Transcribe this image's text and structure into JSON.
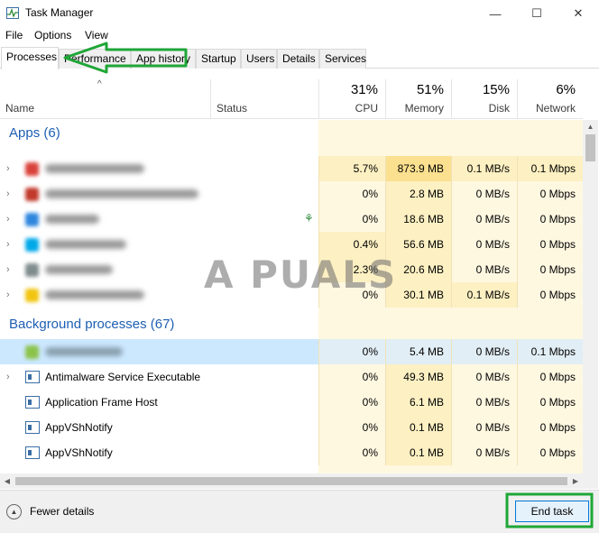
{
  "window": {
    "title": "Task Manager",
    "controls": {
      "minimize": "—",
      "maximize": "☐",
      "close": "✕"
    }
  },
  "menu": [
    "File",
    "Options",
    "View"
  ],
  "tabs": [
    "Processes",
    "Performance",
    "App history",
    "Startup",
    "Users",
    "Details",
    "Services"
  ],
  "active_tab": "Processes",
  "columns": {
    "name": "Name",
    "status": "Status",
    "cpu": {
      "pct": "31%",
      "label": "CPU"
    },
    "memory": {
      "pct": "51%",
      "label": "Memory"
    },
    "disk": {
      "pct": "15%",
      "label": "Disk"
    },
    "network": {
      "pct": "6%",
      "label": "Network"
    }
  },
  "groups": {
    "apps": "Apps (6)",
    "background": "Background processes (67)"
  },
  "app_rows": [
    {
      "cpu": "5.7%",
      "memory": "873.9 MB",
      "disk": "0.1 MB/s",
      "network": "0.1 Mbps",
      "icon_color": "#d9423a"
    },
    {
      "cpu": "0%",
      "memory": "2.8 MB",
      "disk": "0 MB/s",
      "network": "0 Mbps",
      "icon_color": "#c0392b"
    },
    {
      "cpu": "0%",
      "memory": "18.6 MB",
      "disk": "0 MB/s",
      "network": "0 Mbps",
      "icon_color": "#2e86de"
    },
    {
      "cpu": "0.4%",
      "memory": "56.6 MB",
      "disk": "0 MB/s",
      "network": "0 Mbps",
      "icon_color": "#00a8e8"
    },
    {
      "cpu": "2.3%",
      "memory": "20.6 MB",
      "disk": "0 MB/s",
      "network": "0 Mbps",
      "icon_color": "#7f8c8d"
    },
    {
      "cpu": "0%",
      "memory": "30.1 MB",
      "disk": "0.1 MB/s",
      "network": "0 Mbps",
      "icon_color": "#f1c40f"
    }
  ],
  "bg_rows": [
    {
      "name": "",
      "cpu": "0%",
      "memory": "5.4 MB",
      "disk": "0 MB/s",
      "network": "0.1 Mbps",
      "expand": false
    },
    {
      "name": "Antimalware Service Executable",
      "cpu": "0%",
      "memory": "49.3 MB",
      "disk": "0 MB/s",
      "network": "0 Mbps",
      "expand": true
    },
    {
      "name": "Application Frame Host",
      "cpu": "0%",
      "memory": "6.1 MB",
      "disk": "0 MB/s",
      "network": "0 Mbps",
      "expand": false
    },
    {
      "name": "AppVShNotify",
      "cpu": "0%",
      "memory": "0.1 MB",
      "disk": "0 MB/s",
      "network": "0 Mbps",
      "expand": false
    },
    {
      "name": "AppVShNotify",
      "cpu": "0%",
      "memory": "0.1 MB",
      "disk": "0 MB/s",
      "network": "0 Mbps",
      "expand": false
    }
  ],
  "footer": {
    "fewer_details": "Fewer details",
    "end_task": "End task"
  },
  "watermark": "A PUALS",
  "colors": {
    "heat_light": "#fff8e1",
    "heat_mid": "#fdf0c2",
    "heat_strong": "#fbe08f",
    "selected_row": "#cce8ff",
    "group_title": "#1e5fb4",
    "annotation": "#1fa637"
  }
}
